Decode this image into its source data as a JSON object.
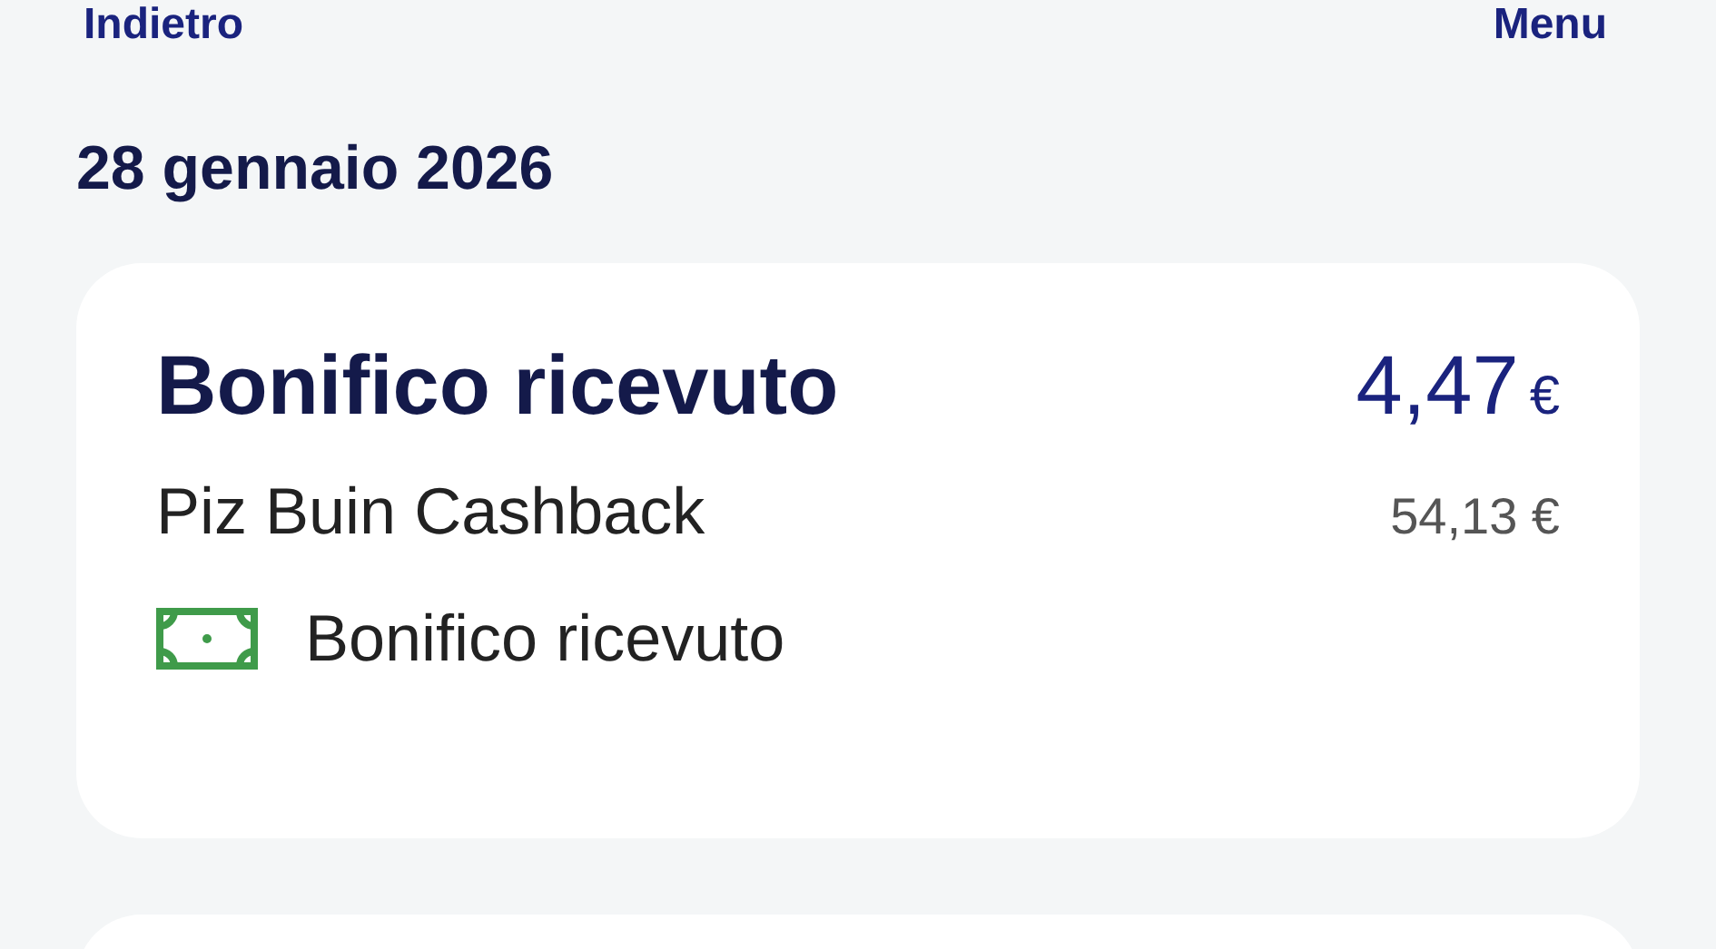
{
  "nav": {
    "back": "Indietro",
    "menu": "Menu"
  },
  "date": "28 gennaio 2026",
  "transaction": {
    "title": "Bonifico ricevuto",
    "amount": "4,47",
    "currency": "€",
    "counterparty": "Piz Buin Cashback",
    "balance": "54,13 €",
    "category": {
      "kind": "transfer",
      "label": "Bonifico ricevuto"
    }
  }
}
